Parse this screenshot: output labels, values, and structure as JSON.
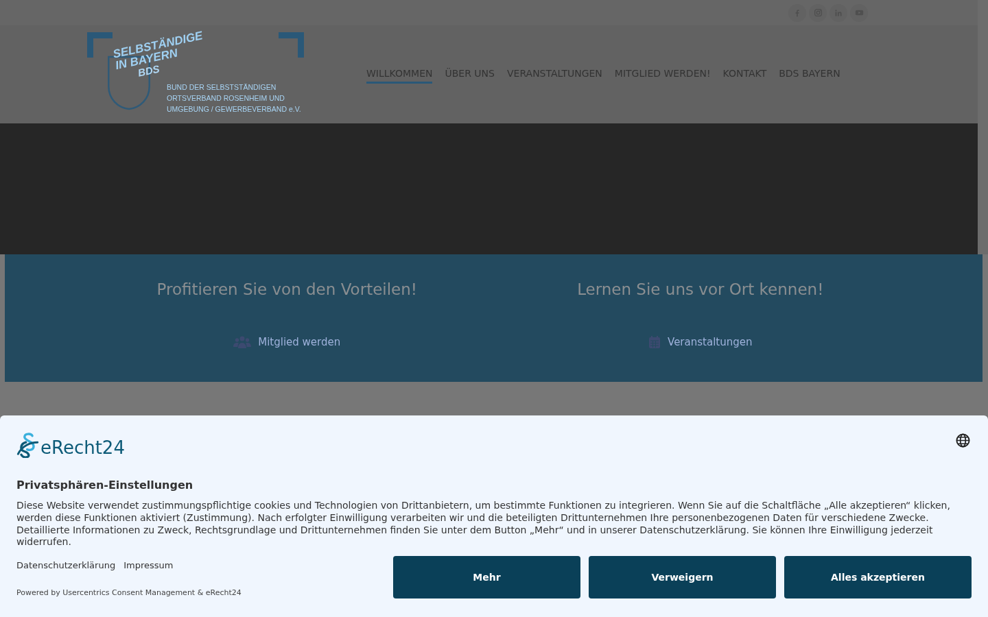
{
  "social_icons": [
    {
      "kind": "facebook"
    },
    {
      "kind": "instagram"
    },
    {
      "kind": "linkedin"
    },
    {
      "kind": "youtube"
    }
  ],
  "logo": {
    "title_lines": [
      "SELBSTÄNDIGE",
      "IN BAYERN"
    ],
    "badge": "BDS",
    "subtitle_lines": [
      "BUND DER SELBSTSTÄNDIGEN",
      "ORTSVERBAND ROSENHEIM UND",
      "UMGEBUNG / GEWERBEVERBAND e.V."
    ]
  },
  "nav": [
    {
      "label": "WILLKOMMEN",
      "selected": true
    },
    {
      "label": "ÜBER UNS",
      "selected": false
    },
    {
      "label": "VERANSTALTUNGEN",
      "selected": false
    },
    {
      "label": "MITGLIED WERDEN!",
      "selected": false
    },
    {
      "label": "KONTAKT",
      "selected": false
    },
    {
      "label": "BDS BAYERN",
      "selected": false
    }
  ],
  "features": [
    {
      "heading": "Profitieren Sie von den Vorteilen!",
      "link": "Mitglied werden",
      "kind": "members"
    },
    {
      "heading": "Lernen Sie uns vor Ort kennen!",
      "link": "Veranstaltungen",
      "kind": "events"
    }
  ],
  "consent": {
    "brand": "eRecht24",
    "title": "Privatsphären-Einstellungen",
    "text": "Diese Website verwendet zustimmungspflichtige cookies und Technologien von Drittanbietern, um bestimmte Funktionen zu integrieren. Wenn Sie auf die Schaltfläche „Alle akzeptieren“ klicken, werden diese Funktionen aktiviert (Zustimmung). Nach erfolgter Einwilligung verarbeiten wir und die beteiligten Drittunternehmen Ihre personenbezogenen Daten für verschiedene Zwecke. Detaillierte Informationen zu Zweck, Rechtsgrundlage und Drittunternehmen finden Sie unter dem Button „Mehr“ und in unserer Datenschutzerklärung. Sie können Ihre Einwilligung jederzeit widerrufen.",
    "links": [
      "Datenschutzerklärung",
      "Impressum"
    ],
    "buttons": [
      "Mehr",
      "Verweigern",
      "Alles akzeptieren"
    ],
    "powered_by": "Powered by Usercentrics Consent Management & eRecht24"
  }
}
